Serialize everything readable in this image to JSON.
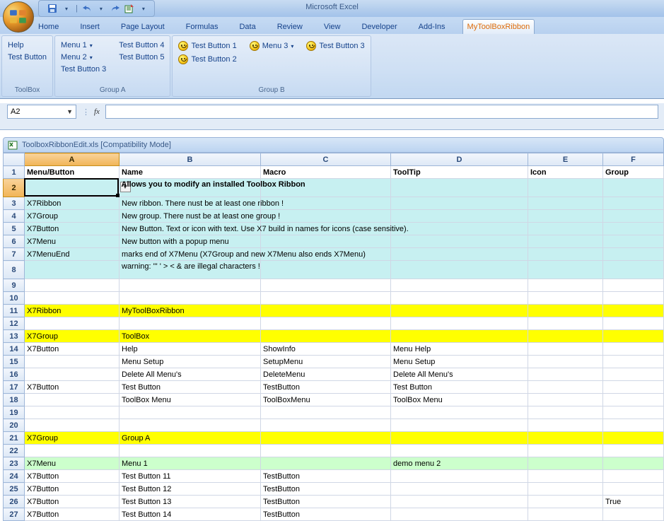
{
  "app_title": "Microsoft Excel",
  "qat": {
    "save": "save-icon",
    "undo": "undo-icon",
    "redo": "redo-icon",
    "export": "export-icon"
  },
  "tabs": [
    "Home",
    "Insert",
    "Page Layout",
    "Formulas",
    "Data",
    "Review",
    "View",
    "Developer",
    "Add-Ins",
    "MyToolBoxRibbon"
  ],
  "active_tab": "MyToolBoxRibbon",
  "ribbon": {
    "groups": [
      {
        "label": "ToolBox",
        "cols": [
          [
            {
              "t": "Help"
            },
            {
              "t": "Test Button"
            }
          ]
        ]
      },
      {
        "label": "Group A",
        "cols": [
          [
            {
              "t": "Menu 1",
              "dd": true
            },
            {
              "t": "Menu 2",
              "dd": true
            },
            {
              "t": "Test Button 3"
            }
          ],
          [
            {
              "t": "Test Button 4"
            },
            {
              "t": "Test Button 5"
            }
          ]
        ]
      },
      {
        "label": "Group B",
        "cols": [
          [
            {
              "t": "Test Button 1",
              "smile": true
            },
            {
              "t": "Test Button 2",
              "smile": true
            }
          ],
          [
            {
              "t": "Menu 3",
              "dd": true,
              "smile": true
            }
          ],
          [
            {
              "t": "Test Button 3",
              "smile": true
            }
          ]
        ]
      }
    ]
  },
  "namebox": "A2",
  "fx_label": "fx",
  "workbook_title": "ToolboxRibbonEdit.xls  [Compatibility Mode]",
  "columns": [
    "A",
    "B",
    "C",
    "D",
    "E",
    "F"
  ],
  "header_row": [
    "Menu/Button",
    "Name",
    "Macro",
    "ToolTip",
    "Icon",
    "Group"
  ],
  "row2_overflow": "Allows you to modify an installed Toolbox Ribbon",
  "rows": [
    {
      "n": 3,
      "cls": "cyan",
      "c": [
        "X7Ribbon",
        "New ribbon.   There nust be at least one ribbon !",
        "",
        "",
        "",
        ""
      ]
    },
    {
      "n": 4,
      "cls": "cyan",
      "c": [
        "X7Group",
        "New group.   There nust be at least one group !",
        "",
        "",
        "",
        ""
      ]
    },
    {
      "n": 5,
      "cls": "cyan",
      "c": [
        "X7Button",
        "New Button.  Text or icon with text. Use X7 build in names for icons (case sensitive).",
        "",
        "",
        "",
        ""
      ]
    },
    {
      "n": 6,
      "cls": "cyan",
      "c": [
        "X7Menu",
        "New button with a popup menu",
        "",
        "",
        "",
        ""
      ]
    },
    {
      "n": 7,
      "cls": "cyan",
      "c": [
        "X7MenuEnd",
        "marks end of X7Menu (X7Group and new X7Menu also ends X7Menu)",
        "",
        "",
        "",
        ""
      ]
    },
    {
      "n": 8,
      "cls": "cyan tall",
      "c": [
        "",
        "warning: '\" '  > < & are illegal characters !",
        "",
        "",
        "",
        ""
      ]
    },
    {
      "n": 9,
      "cls": "",
      "c": [
        "",
        "",
        "",
        "",
        "",
        ""
      ]
    },
    {
      "n": 10,
      "cls": "",
      "c": [
        "",
        "",
        "",
        "",
        "",
        ""
      ]
    },
    {
      "n": 11,
      "cls": "yellow",
      "c": [
        "X7Ribbon",
        "MyToolBoxRibbon",
        "",
        "",
        "",
        ""
      ]
    },
    {
      "n": 12,
      "cls": "",
      "c": [
        "",
        "",
        "",
        "",
        "",
        ""
      ]
    },
    {
      "n": 13,
      "cls": "yellow",
      "c": [
        "X7Group",
        "ToolBox",
        "",
        "",
        "",
        ""
      ]
    },
    {
      "n": 14,
      "cls": "",
      "c": [
        "X7Button",
        "Help",
        "ShowInfo",
        "Menu Help",
        "",
        ""
      ]
    },
    {
      "n": 15,
      "cls": "",
      "c": [
        "",
        "Menu Setup",
        "SetupMenu",
        "Menu Setup",
        "",
        ""
      ]
    },
    {
      "n": 16,
      "cls": "",
      "c": [
        "",
        "Delete All Menu's",
        "DeleteMenu",
        "Delete All Menu's",
        "",
        ""
      ]
    },
    {
      "n": 17,
      "cls": "",
      "c": [
        "X7Button",
        "Test Button",
        "TestButton",
        "Test Button",
        "",
        ""
      ]
    },
    {
      "n": 18,
      "cls": "",
      "c": [
        "",
        "ToolBox Menu",
        "ToolBoxMenu",
        "ToolBox Menu",
        "",
        ""
      ]
    },
    {
      "n": 19,
      "cls": "",
      "c": [
        "",
        "",
        "",
        "",
        "",
        ""
      ]
    },
    {
      "n": 20,
      "cls": "",
      "c": [
        "",
        "",
        "",
        "",
        "",
        ""
      ]
    },
    {
      "n": 21,
      "cls": "yellow",
      "c": [
        "X7Group",
        "Group A",
        "",
        "",
        "",
        ""
      ]
    },
    {
      "n": 22,
      "cls": "",
      "c": [
        "",
        "",
        "",
        "",
        "",
        ""
      ]
    },
    {
      "n": 23,
      "cls": "green",
      "c": [
        "X7Menu",
        "Menu 1",
        "",
        "demo menu 2",
        "",
        ""
      ]
    },
    {
      "n": 24,
      "cls": "",
      "c": [
        "X7Button",
        "Test Button 11",
        "TestButton",
        "",
        "",
        ""
      ]
    },
    {
      "n": 25,
      "cls": "",
      "c": [
        "X7Button",
        "Test Button 12",
        "TestButton",
        "",
        "",
        ""
      ]
    },
    {
      "n": 26,
      "cls": "",
      "c": [
        "X7Button",
        "Test Button 13",
        "TestButton",
        "",
        "",
        "True"
      ]
    },
    {
      "n": 27,
      "cls": "",
      "c": [
        "X7Button",
        "Test Button 14",
        "TestButton",
        "",
        "",
        ""
      ]
    }
  ]
}
